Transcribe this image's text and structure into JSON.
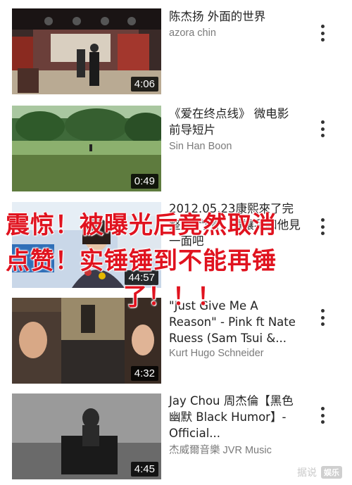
{
  "videos": [
    {
      "title": "陈杰扬 外面的世界",
      "channel": "azora chin",
      "duration": "4:06"
    },
    {
      "title": "《爱在终点线》 微电影 前导短片",
      "channel": "Sin Han Boon",
      "duration": "0:49"
    },
    {
      "title": "2012.05.23康熙來了完整版 鬥嘴，請讓我和他見一面吧",
      "channel": "",
      "duration": "44:57"
    },
    {
      "title": "\"Just Give Me A Reason\" - Pink ft Nate Ruess (Sam Tsui &...",
      "channel": "Kurt Hugo Schneider",
      "duration": "4:32"
    },
    {
      "title": "Jay Chou 周杰倫【黑色幽默 Black Humor】-Official...",
      "channel": "杰威爾音樂 JVR Music",
      "duration": "4:45"
    }
  ],
  "overlay": {
    "line1": "震惊！被曝光后竟然取消",
    "line2": "点赞！实锤锤到不能再锤",
    "line3": "了！！！"
  },
  "watermark": {
    "text": "据说",
    "badge": "娱乐"
  },
  "icons": {
    "menu": "more-vert-icon"
  },
  "colors": {
    "overlay_text": "#e0131f",
    "channel_text": "#7a7a7a"
  }
}
